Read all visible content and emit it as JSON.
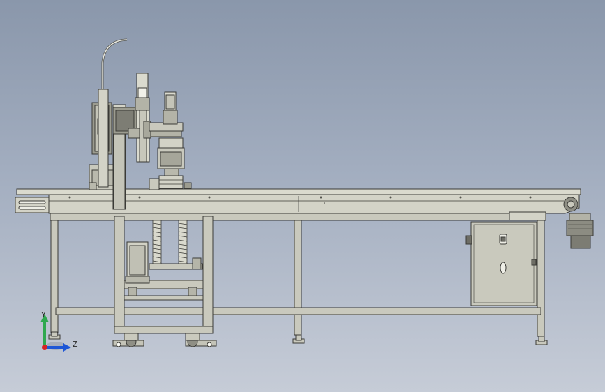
{
  "triad": {
    "y_label": "Y",
    "z_label": "Z",
    "colors": {
      "y_axis": "#2fa84f",
      "z_axis": "#1d56d6",
      "x_origin": "#d42525"
    }
  },
  "colors": {
    "background_top": "#8a97ab",
    "background_bottom": "#c6ccd7",
    "metal_fill": "#c9c9bd",
    "metal_light": "#dadace",
    "metal_dark": "#9c9c90",
    "outline": "#3a3a36"
  }
}
